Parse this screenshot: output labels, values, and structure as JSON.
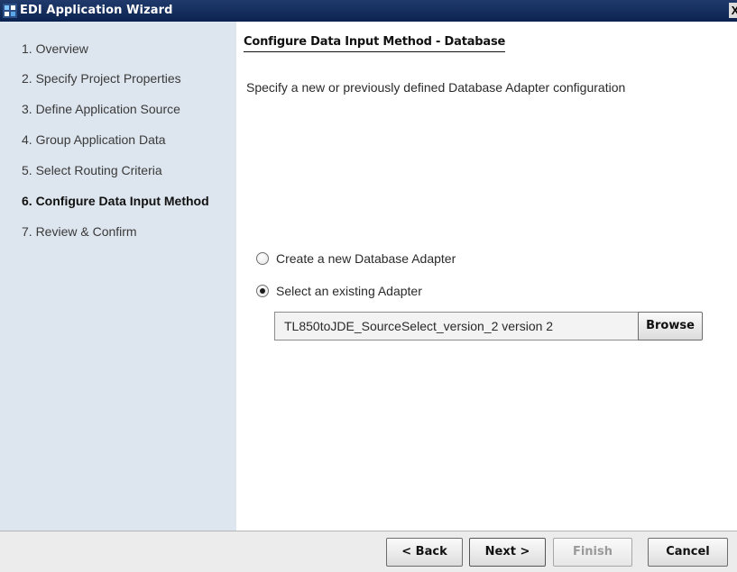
{
  "window": {
    "title": "EDI Application Wizard",
    "close_label": "X"
  },
  "sidebar": {
    "steps": [
      {
        "label": "1. Overview",
        "active": false
      },
      {
        "label": "2. Specify Project Properties",
        "active": false
      },
      {
        "label": "3. Define Application Source",
        "active": false
      },
      {
        "label": "4. Group Application Data",
        "active": false
      },
      {
        "label": "5. Select Routing Criteria",
        "active": false
      },
      {
        "label": "6. Configure Data Input Method",
        "active": true
      },
      {
        "label": "7. Review & Confirm",
        "active": false
      }
    ]
  },
  "main": {
    "heading": "Configure Data Input Method - Database",
    "description": "Specify a new or previously defined Database Adapter configuration",
    "options": [
      {
        "label": "Create a new Database Adapter",
        "checked": false
      },
      {
        "label": "Select an existing Adapter",
        "checked": true
      }
    ],
    "adapter_value": "TL850toJDE_SourceSelect_version_2 version 2",
    "browse_label": "Browse"
  },
  "footer": {
    "back_label": "< Back",
    "next_label": "Next >",
    "finish_label": "Finish",
    "cancel_label": "Cancel"
  },
  "colors": {
    "titlebar": "#0c2350",
    "sidebar_bg": "#dde5ee",
    "footer_bg": "#ececec"
  },
  "icons": {
    "app": "app-grid-icon",
    "close": "close-icon"
  }
}
